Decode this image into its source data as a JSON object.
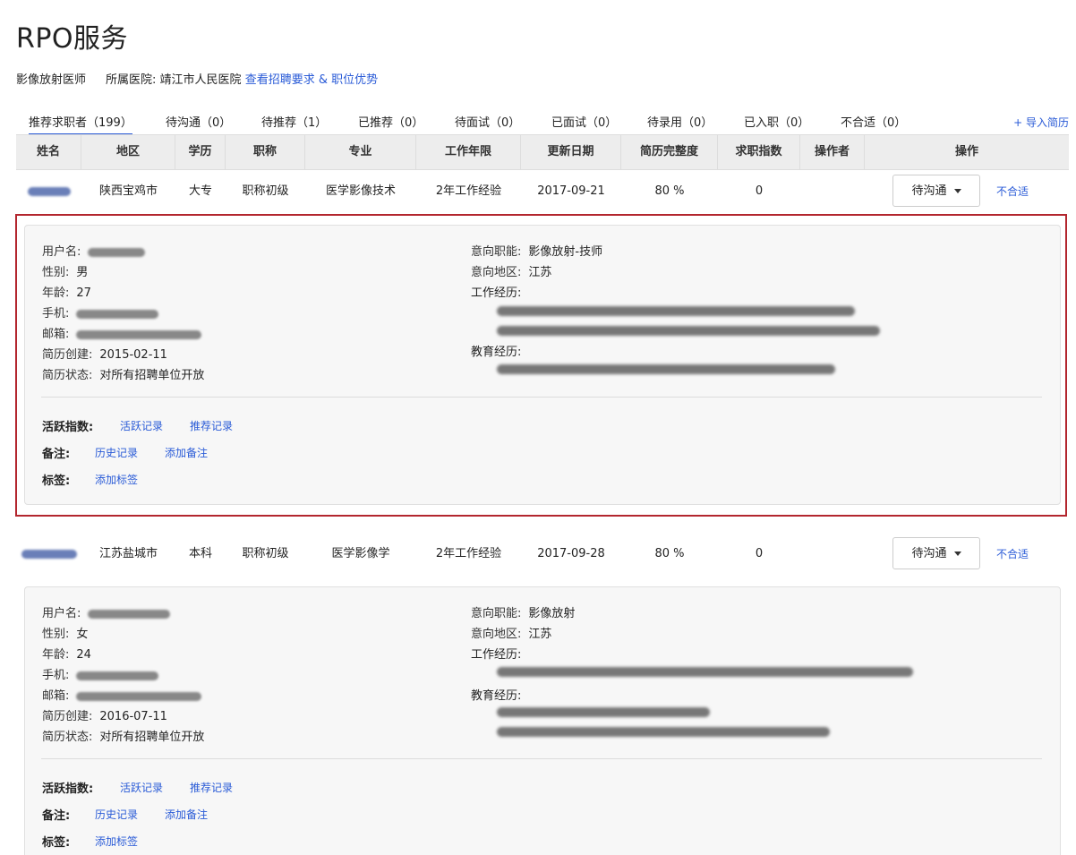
{
  "page": {
    "title": "RPO服务"
  },
  "job": {
    "position": "影像放射医师",
    "hospital_label": "所属医院:",
    "hospital": "靖江市人民医院",
    "requirements_link": "查看招聘要求 & 职位优势"
  },
  "tabs": [
    {
      "label": "推荐求职者（199）",
      "active": true
    },
    {
      "label": "待沟通（0）"
    },
    {
      "label": "待推荐（1）"
    },
    {
      "label": "已推荐（0）"
    },
    {
      "label": "待面试（0）"
    },
    {
      "label": "已面试（0）"
    },
    {
      "label": "待录用（0）"
    },
    {
      "label": "已入职（0）"
    },
    {
      "label": "不合适（0）"
    }
  ],
  "import_resume": "+ 导入简历",
  "table": {
    "columns": [
      "姓名",
      "地区",
      "学历",
      "职称",
      "专业",
      "工作年限",
      "更新日期",
      "简历完整度",
      "求职指数",
      "操作者",
      "操作"
    ]
  },
  "candidates": [
    {
      "region": "陕西宝鸡市",
      "education": "大专",
      "title": "职称初级",
      "major": "医学影像技术",
      "experience": "2年工作经验",
      "updated": "2017-09-21",
      "completeness": "80 %",
      "index": "0",
      "status_button": "待沟通",
      "unfit_link": "不合适",
      "detail": {
        "username_label": "用户名:",
        "gender_label": "性别:",
        "gender": "男",
        "age_label": "年龄:",
        "age": "27",
        "phone_label": "手机:",
        "email_label": "邮箱:",
        "created_label": "简历创建:",
        "created": "2015-02-11",
        "state_label": "简历状态:",
        "state": "对所有招聘单位开放",
        "intent_job_label": "意向职能:",
        "intent_job": "影像放射-技师",
        "intent_region_label": "意向地区:",
        "intent_region": "江苏",
        "work_label": "工作经历:",
        "edu_label": "教育经历:"
      }
    },
    {
      "region": "江苏盐城市",
      "education": "本科",
      "title": "职称初级",
      "major": "医学影像学",
      "experience": "2年工作经验",
      "updated": "2017-09-28",
      "completeness": "80 %",
      "index": "0",
      "status_button": "待沟通",
      "unfit_link": "不合适",
      "detail": {
        "username_label": "用户名:",
        "gender_label": "性别:",
        "gender": "女",
        "age_label": "年龄:",
        "age": "24",
        "phone_label": "手机:",
        "email_label": "邮箱:",
        "created_label": "简历创建:",
        "created": "2016-07-11",
        "state_label": "简历状态:",
        "state": "对所有招聘单位开放",
        "intent_job_label": "意向职能:",
        "intent_job": "影像放射",
        "intent_region_label": "意向地区:",
        "intent_region": "江苏",
        "work_label": "工作经历:",
        "edu_label": "教育经历:"
      }
    }
  ],
  "actions": {
    "activity_label": "活跃指数:",
    "activity_log": "活跃记录",
    "recommend_log": "推荐记录",
    "note_label": "备注:",
    "history_log": "历史记录",
    "add_note": "添加备注",
    "tag_label": "标签:",
    "add_tag": "添加标签"
  },
  "colors": {
    "link": "#2a5bd7",
    "highlight_border": "#b3262e"
  }
}
